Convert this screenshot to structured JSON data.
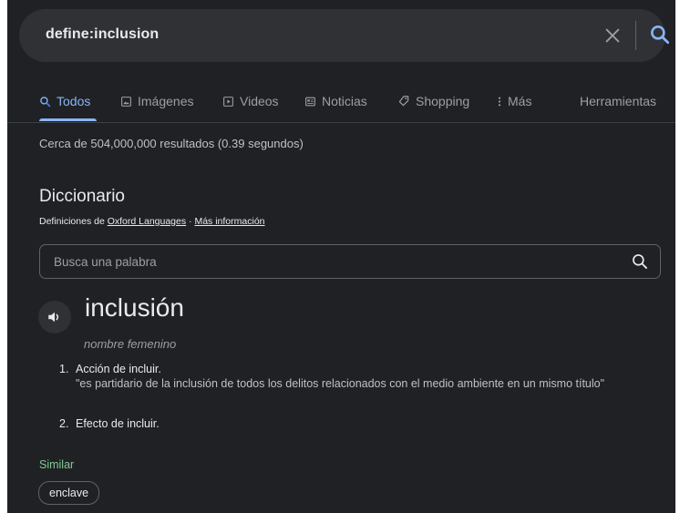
{
  "search": {
    "query": "define:inclusion"
  },
  "tabs": [
    {
      "label": "Todos",
      "icon": "search-icon"
    },
    {
      "label": "Imágenes",
      "icon": "image-icon"
    },
    {
      "label": "Videos",
      "icon": "video-icon"
    },
    {
      "label": "Noticias",
      "icon": "news-icon"
    },
    {
      "label": "Shopping",
      "icon": "tag-icon"
    },
    {
      "label": "Más",
      "icon": "more-vertical-icon"
    },
    {
      "label": "Herramientas"
    }
  ],
  "results": {
    "stats": "Cerca de 504,000,000 resultados (0.39 segundos)"
  },
  "dictionary": {
    "title": "Diccionario",
    "source_prefix": "Definiciones de",
    "source_link": "Oxford Languages",
    "separator": "·",
    "more_info": "Más información",
    "search_placeholder": "Busca una palabra",
    "word": "inclusión",
    "part_of_speech": "nombre femenino",
    "definitions": [
      {
        "num": "1.",
        "text": "Acción de incluir.",
        "example": "\"es partidario de la inclusión de todos los delitos relacionados con el medio ambiente en un mismo título\""
      },
      {
        "num": "2.",
        "text": "Efecto de incluir."
      }
    ],
    "similar_label": "Similar",
    "similar": [
      "enclave"
    ]
  },
  "colors": {
    "background": "#202124",
    "accent": "#8ab4f8",
    "similar": "#81c995",
    "text": "#e8eaed",
    "muted": "#9aa0a6"
  }
}
